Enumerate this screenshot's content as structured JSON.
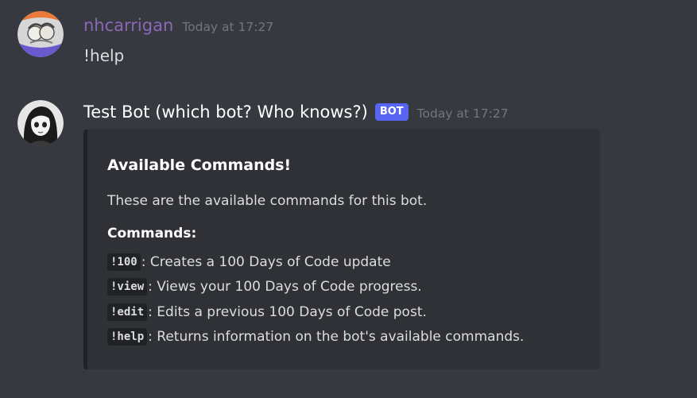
{
  "messages": [
    {
      "username": "nhcarrigan",
      "username_color": "#8c67b8",
      "timestamp": "Today at 17:27",
      "content": "!help"
    },
    {
      "username": "Test Bot (which bot? Who knows?)",
      "username_color": "#ffffff",
      "bot_tag": "BOT",
      "timestamp": "Today at 17:27",
      "embed": {
        "title": "Available Commands!",
        "description": "These are the available commands for this bot.",
        "field_name": "Commands:",
        "commands": [
          {
            "command": "!100",
            "description": ": Creates a 100 Days of Code update"
          },
          {
            "command": "!view",
            "description": ": Views your 100 Days of Code progress."
          },
          {
            "command": "!edit",
            "description": ": Edits a previous 100 Days of Code post."
          },
          {
            "command": "!help",
            "description": ": Returns information on the bot's available commands."
          }
        ]
      }
    }
  ],
  "colors": {
    "background": "#36393f",
    "embed_background": "#2f3136",
    "embed_border": "#202225",
    "bot_tag": "#5865f2",
    "timestamp": "#72767d"
  }
}
